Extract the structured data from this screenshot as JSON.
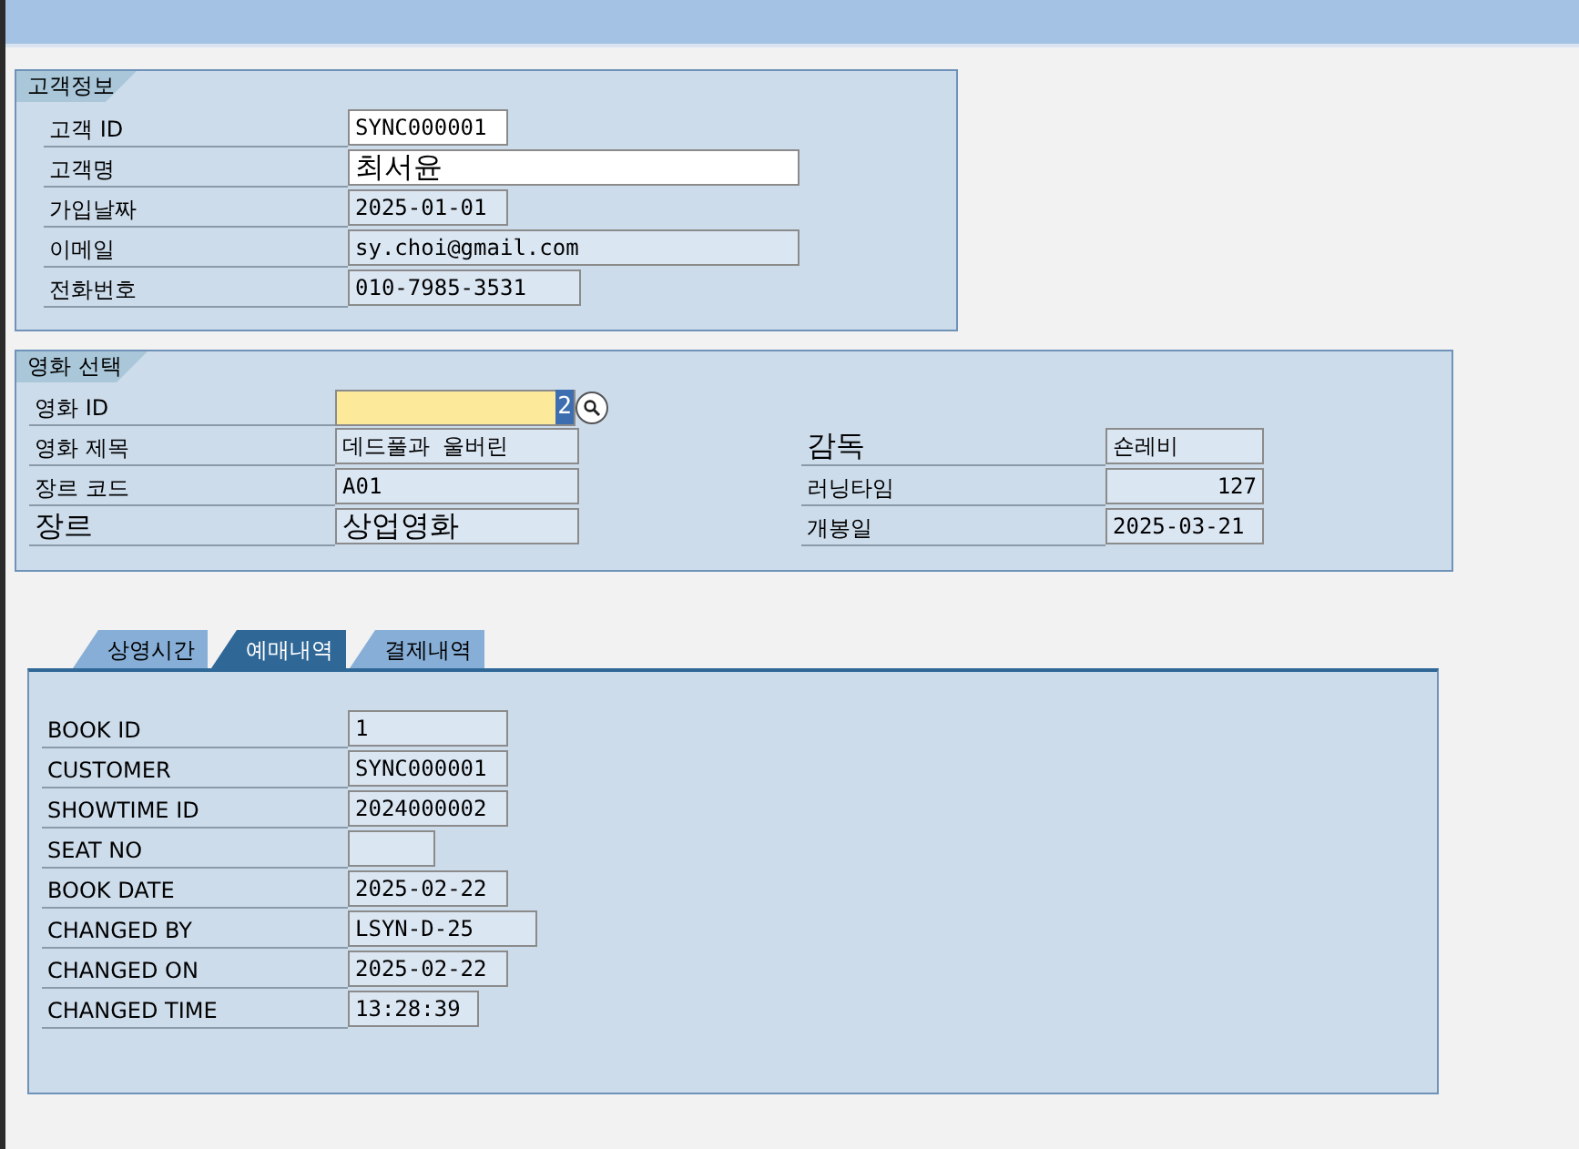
{
  "customer_group": {
    "title": "고객정보",
    "fields": [
      {
        "label": "고객 ID",
        "value": "SYNC000001",
        "editable": true
      },
      {
        "label": "고객명",
        "value": "최서윤",
        "editable": true
      },
      {
        "label": "가입날짜",
        "value": "2025-01-01",
        "editable": false
      },
      {
        "label": "이메일",
        "value": "sy.choi@gmail.com",
        "editable": false
      },
      {
        "label": "전화번호",
        "value": "010-7985-3531",
        "editable": false
      }
    ]
  },
  "movie_group": {
    "title": "영화 선택",
    "movie_id": {
      "label": "영화 ID",
      "value": "2",
      "required": true
    },
    "left_fields": [
      {
        "label": "영화 제목",
        "value": "데드풀과 울버린"
      },
      {
        "label": "장르 코드",
        "value": "A01"
      },
      {
        "label": "장르",
        "value": "상업영화"
      }
    ],
    "right_fields": [
      {
        "label": "감독",
        "value": "숀레비"
      },
      {
        "label": "러닝타임",
        "value": "127"
      },
      {
        "label": "개봉일",
        "value": "2025-03-21"
      }
    ]
  },
  "tabs": [
    {
      "label": "상영시간",
      "selected": false
    },
    {
      "label": "예매내역",
      "selected": true
    },
    {
      "label": "결제내역",
      "selected": false
    }
  ],
  "booking_fields": [
    {
      "label": "BOOK ID",
      "value": "1"
    },
    {
      "label": "CUSTOMER",
      "value": "SYNC000001"
    },
    {
      "label": "SHOWTIME ID",
      "value": "2024000002"
    },
    {
      "label": "SEAT NO"
    },
    {
      "label": "BOOK DATE",
      "value": "2025-02-22"
    },
    {
      "label": "CHANGED BY",
      "value": "LSYN-D-25"
    },
    {
      "label": "CHANGED ON",
      "value": "2025-02-22"
    },
    {
      "label": "CHANGED TIME",
      "value": "13:28:39"
    }
  ]
}
